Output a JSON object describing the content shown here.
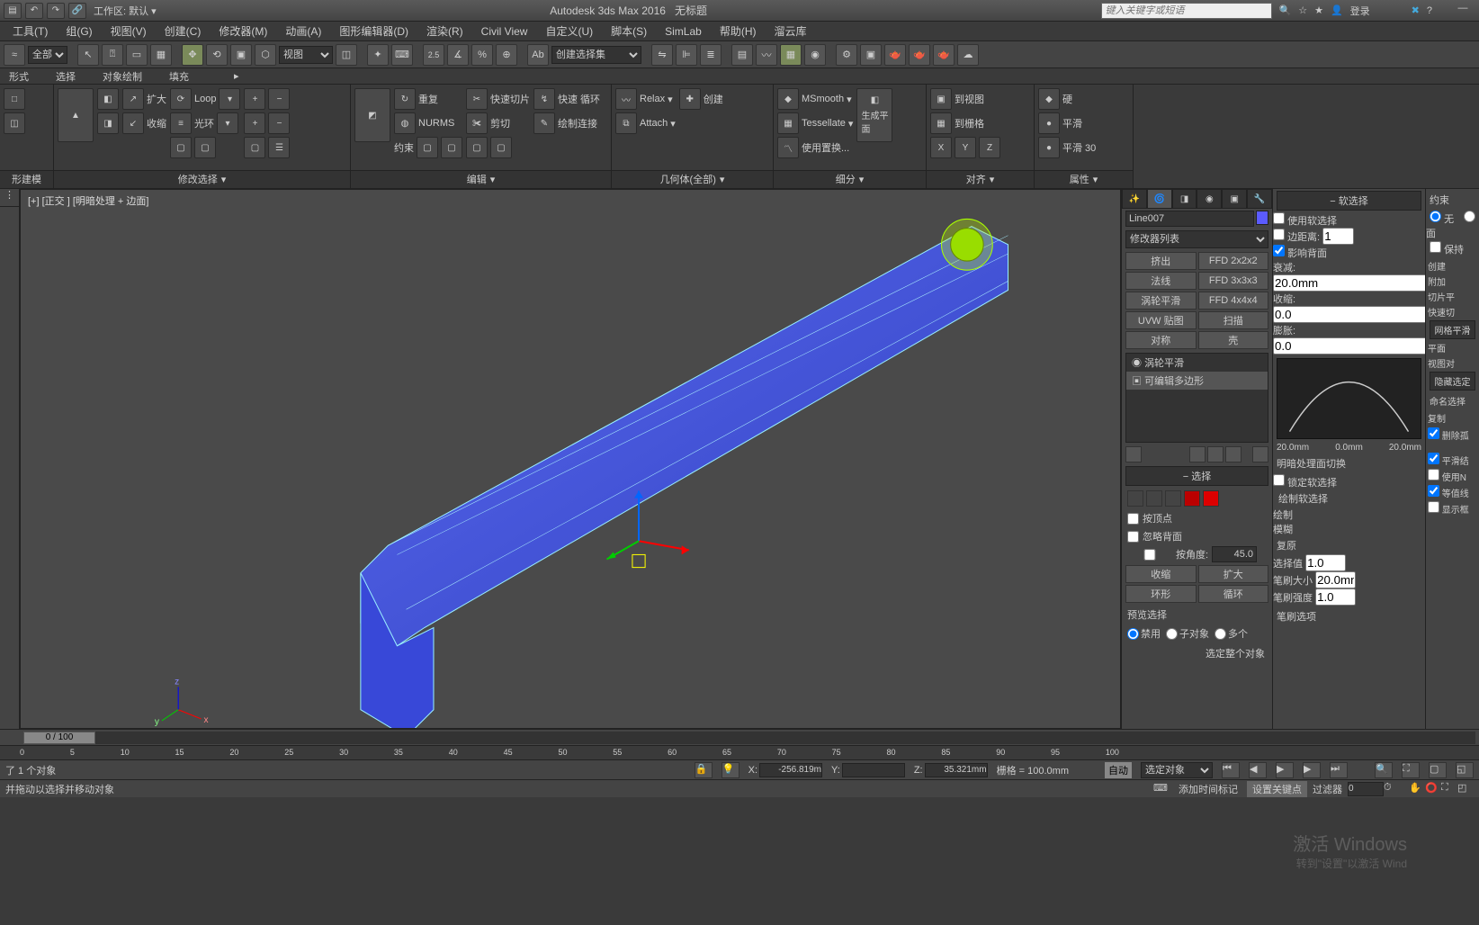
{
  "titlebar": {
    "workspace_label": "工作区:",
    "workspace_value": "默认",
    "app_title": "Autodesk 3ds Max 2016",
    "doc_title": "无标题",
    "search_placeholder": "键入关键字或短语",
    "login": "登录"
  },
  "menubar": {
    "items": [
      "工具(T)",
      "组(G)",
      "视图(V)",
      "创建(C)",
      "修改器(M)",
      "动画(A)",
      "图形编辑器(D)",
      "渲染(R)",
      "Civil View",
      "自定义(U)",
      "脚本(S)",
      "SimLab",
      "帮助(H)",
      "溜云库"
    ]
  },
  "toolbar1": {
    "filter": "全部",
    "view_dd": "视图",
    "set_dd": "创建选择集",
    "num": "2.5"
  },
  "ribbon": {
    "group1": "形建模",
    "group2": "修改选择",
    "group3": "编辑",
    "group4": "几何体(全部)",
    "group5": "细分",
    "group6": "对齐",
    "group7": "属性",
    "row_labels": {
      "expand": "扩大",
      "shrink": "收缩",
      "loop": "Loop",
      "ring": "光环",
      "repeat": "重复",
      "quickslice": "快速切片",
      "quickloop": "快速 循环",
      "nurms": "NURMS",
      "cut": "剪切",
      "paintconnect": "绘制连接",
      "constrain": "约束",
      "relax": "Relax",
      "create": "创建",
      "attach": "Attach",
      "msmooth": "MSmooth",
      "tessellate": "Tessellate",
      "usereplace": "使用置换...",
      "genplane": "生成平面",
      "toview": "到视图",
      "togrid": "到栅格",
      "x": "X",
      "y": "Y",
      "z": "Z",
      "hard": "硬",
      "smooth": "平滑",
      "smooth30": "平滑 30"
    }
  },
  "leftpanel_label": "形式",
  "leftpanel_labels": [
    "选择",
    "对象绘制",
    "填充"
  ],
  "viewport": {
    "label": "[+] [正交 ] [明暗处理 + 边面]"
  },
  "cmdpanel": {
    "objname": "Line007",
    "modlist_label": "修改器列表",
    "buttons": [
      "挤出",
      "FFD 2x2x2",
      "法线",
      "FFD 3x3x3",
      "涡轮平滑",
      "FFD 4x4x4",
      "UVW 贴图",
      "扫描",
      "对称",
      "壳"
    ],
    "stack": [
      "涡轮平滑",
      "可编辑多边形"
    ],
    "roll_select": "选择",
    "byvertex": "按顶点",
    "ignoreback": "忽略背面",
    "byangle": "按角度:",
    "byangle_val": "45.0",
    "shrink": "收缩",
    "grow": "扩大",
    "ring": "环形",
    "loop": "循环",
    "preview_sel": "预览选择",
    "disable": "禁用",
    "subobj": "子对象",
    "multi": "多个",
    "select_whole": "选定整个对象"
  },
  "softsel": {
    "title": "软选择",
    "use": "使用软选择",
    "edgedist": "边距离:",
    "edgedist_val": "1",
    "affectback": "影响背面",
    "falloff": "衰减:",
    "falloff_val": "20.0mm",
    "pinch": "收缩:",
    "pinch_val": "0.0",
    "bubble": "膨胀:",
    "bubble_val": "0.0",
    "scale_left": "20.0mm",
    "scale_mid": "0.0mm",
    "scale_right": "20.0mm",
    "shadeface": "明暗处理面切换",
    "locksoft": "锁定软选择",
    "paintsoft_title": "绘制软选择",
    "paint": "绘制",
    "blur": "模糊",
    "revert": "复原",
    "selval": "选择值",
    "selval_v": "1.0",
    "brushsize": "笔刷大小",
    "brushsize_v": "20.0mm",
    "brushstr": "笔刷强度",
    "brushstr_v": "1.0",
    "brushopt": "笔刷选项"
  },
  "panel3": {
    "constraint": "约束",
    "none": "无",
    "face": "面",
    "preserve": "保持",
    "create": "创建",
    "attach": "附加",
    "sliceplane": "切片平",
    "quickslice": "快速切",
    "meshsmooth_t": "网格平滑",
    "planarize": "平面",
    "viewalign": "视图对",
    "hide_t": "隐藏选定",
    "name_sel": "命名选择",
    "copy": "复制",
    "delete_iso": "删除孤",
    "b_smooth": "平滑结",
    "b_usen": "使用N",
    "b_equal": "等值线",
    "b_show": "显示框"
  },
  "timeline": {
    "pos": "0 / 100",
    "ticks": [
      "0",
      "5",
      "10",
      "15",
      "20",
      "25",
      "30",
      "35",
      "40",
      "45",
      "50",
      "55",
      "60",
      "65",
      "70",
      "75",
      "80",
      "85",
      "90",
      "95",
      "100"
    ]
  },
  "status": {
    "line1": "了 1 个对象",
    "line2": "并拖动以选择并移动对象",
    "x": "-256.819m",
    "y": "",
    "z": "35.321mm",
    "grid": "栅格",
    "grid_val": "= 100.0mm",
    "auto": "自动",
    "sel_obj": "选定对象",
    "addtime": "添加时间标记",
    "setkey": "设置关键点",
    "filter": "过滤器"
  },
  "watermark": {
    "line1": "激活 Windows",
    "line2": "转到\"设置\"以激活 Wind"
  }
}
